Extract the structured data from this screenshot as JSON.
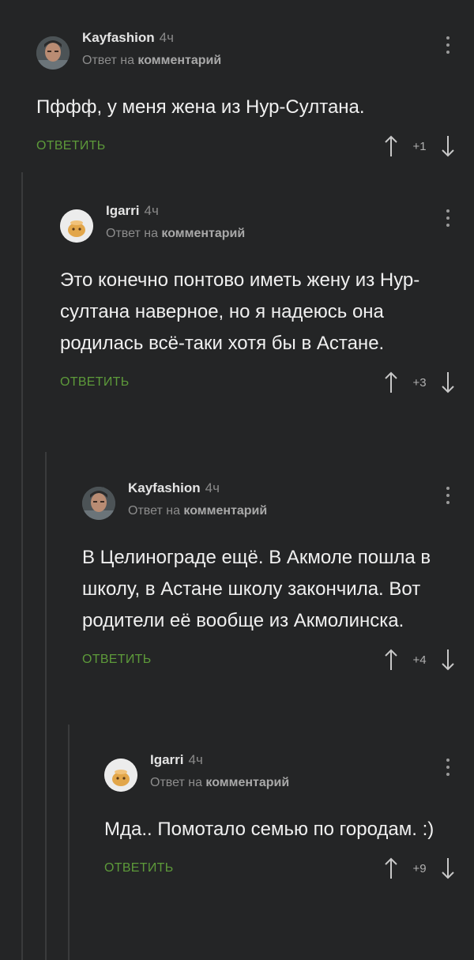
{
  "comments": [
    {
      "author": "Kayfashion",
      "time": "4ч",
      "reply_prefix": "Ответ на",
      "reply_target": "комментарий",
      "text": "Пффф, у меня жена из Нур-Султана.",
      "reply_label": "ОТВЕТИТЬ",
      "score": "+1",
      "avatar": "user-photo"
    },
    {
      "author": "Igarri",
      "time": "4ч",
      "reply_prefix": "Ответ на",
      "reply_target": "комментарий",
      "text": "Это конечно понтово иметь жену из Нур-султана наверное, но я надеюсь она родилась всё-таки хотя бы в Астане.",
      "reply_label": "ОТВЕТИТЬ",
      "score": "+3",
      "avatar": "cartoon-head"
    },
    {
      "author": "Kayfashion",
      "time": "4ч",
      "reply_prefix": "Ответ на",
      "reply_target": "комментарий",
      "text": "В Целинограде ещё. В Акмоле пошла в школу, в Астане школу закончила. Вот родители её вообще из Акмолинска.",
      "reply_label": "ОТВЕТИТЬ",
      "score": "+4",
      "avatar": "user-photo"
    },
    {
      "author": "Igarri",
      "time": "4ч",
      "reply_prefix": "Ответ на",
      "reply_target": "комментарий",
      "text": "Мда.. Помотало семью по городам. :)",
      "reply_label": "ОТВЕТИТЬ",
      "score": "+9",
      "avatar": "cartoon-head"
    }
  ],
  "colors": {
    "accent": "#5d9a3a",
    "background": "#242526",
    "thread_line": "#3a3b3c"
  }
}
